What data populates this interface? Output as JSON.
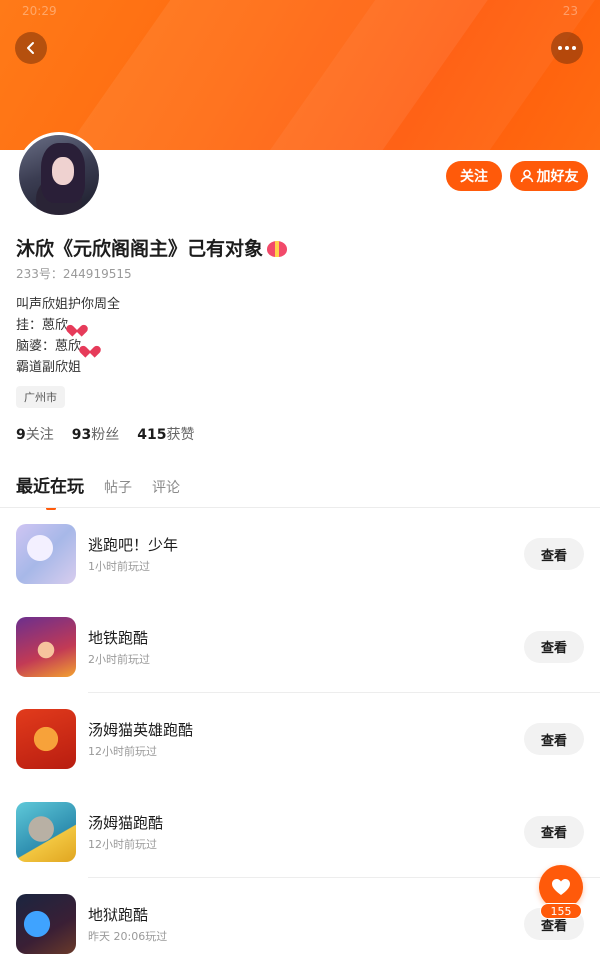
{
  "status_bar": {
    "time": "20:29",
    "battery": "23"
  },
  "header": {
    "back_icon": "chevron-left-icon",
    "more_icon": "more-dots-icon"
  },
  "profile": {
    "name": "沐欣《元欣阁阁主》己有对象",
    "uid_label": "233号：244919515",
    "bio": [
      "叫声欣姐护你周全",
      "挂：蒽欣",
      "脑婆：蒽欣",
      "霸道副欣姐"
    ],
    "location": "广州市",
    "follow_label": "关注",
    "add_friend_label": "加好友"
  },
  "stats": [
    {
      "num": "9",
      "label": "关注"
    },
    {
      "num": "93",
      "label": "粉丝"
    },
    {
      "num": "415",
      "label": "获赞"
    }
  ],
  "tabs": [
    "最近在玩",
    "帖子",
    "评论"
  ],
  "games": [
    {
      "title": "逃跑吧！少年",
      "played": "1小时前玩过",
      "action": "查看"
    },
    {
      "title": "地铁跑酷",
      "played": "2小时前玩过",
      "action": "查看"
    },
    {
      "title": "汤姆猫英雄跑酷",
      "played": "12小时前玩过",
      "action": "查看"
    },
    {
      "title": "汤姆猫跑酷",
      "played": "12小时前玩过",
      "action": "查看"
    },
    {
      "title": "地狱跑酷",
      "played": "昨天 20:06玩过",
      "action": "查看"
    }
  ],
  "favorite": {
    "count": "155",
    "icon": "heart-icon"
  },
  "colors": {
    "accent": "#ff5a0a"
  }
}
